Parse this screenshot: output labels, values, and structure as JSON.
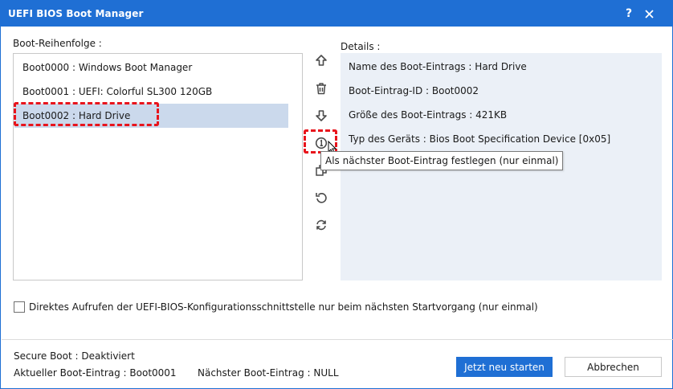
{
  "window": {
    "title": "UEFI BIOS Boot Manager",
    "help_label": "?",
    "accent_color": "#1f6fd4",
    "highlight_color": "#e8141c"
  },
  "boot_order": {
    "label": "Boot-Reihenfolge :",
    "items": [
      {
        "label": "Boot0000 : Windows Boot Manager"
      },
      {
        "label": "Boot0001 : UEFI: Colorful SL300 120GB"
      },
      {
        "label": "Boot0002 : Hard Drive"
      }
    ],
    "selected_index": 2
  },
  "toolbar": {
    "tools": [
      {
        "icon": "arrow-up-icon",
        "name": "move-up"
      },
      {
        "icon": "trash-icon",
        "name": "delete"
      },
      {
        "icon": "arrow-down-icon",
        "name": "move-down"
      },
      {
        "icon": "set-next-boot-icon",
        "name": "set-next-boot"
      },
      {
        "icon": "copy-icon",
        "name": "copy"
      },
      {
        "icon": "undo-icon",
        "name": "undo"
      },
      {
        "icon": "refresh-icon",
        "name": "refresh"
      }
    ],
    "tooltip": "Als nächster Boot-Eintrag festlegen (nur einmal)"
  },
  "details": {
    "label": "Details :",
    "rows": [
      {
        "text": "Name des Boot-Eintrags :  Hard Drive"
      },
      {
        "text": "Boot-Eintrag-ID :  Boot0002"
      },
      {
        "text": "Größe des Boot-Eintrags :  421KB"
      },
      {
        "text": "Typ des Geräts :  Bios Boot Specification Device [0x05]"
      }
    ]
  },
  "options": {
    "direct_uefi_label": "Direktes Aufrufen der UEFI-BIOS-Konfigurationsschnittstelle nur beim nächsten Startvorgang (nur einmal)",
    "direct_uefi_checked": false
  },
  "status": {
    "secure_boot": "Secure Boot :  Deaktiviert",
    "current_entry": "Aktueller Boot-Eintrag :  Boot0001",
    "next_entry": "Nächster Boot-Eintrag :  NULL"
  },
  "buttons": {
    "restart_label": "Jetzt neu starten",
    "cancel_label": "Abbrechen"
  }
}
